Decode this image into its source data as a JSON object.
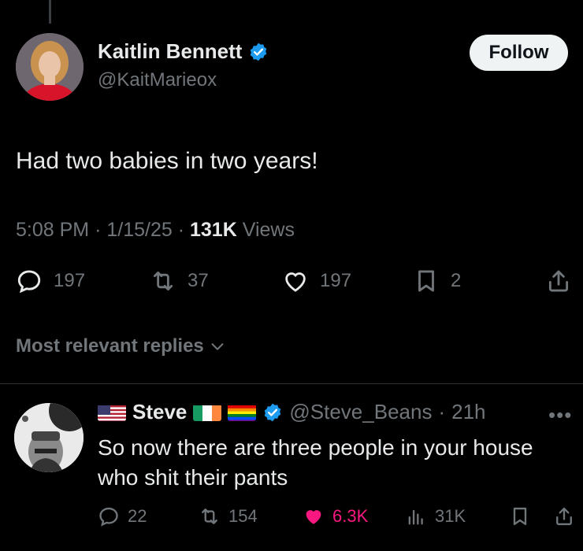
{
  "tweet": {
    "author_name": "Kaitlin Bennett",
    "author_handle": "@KaitMarieox",
    "follow_label": "Follow",
    "text": "Had two babies in two years!",
    "time": "5:08 PM",
    "date": "1/15/25",
    "views_count": "131K",
    "views_label": "Views",
    "separator": "·",
    "replies": "197",
    "reposts": "37",
    "likes": "197",
    "bookmarks": "2"
  },
  "replies_filter": {
    "label": "Most relevant replies"
  },
  "reply": {
    "author_name": "Steve",
    "author_handle": "@Steve_Beans",
    "time_ago": "21h",
    "separator": "·",
    "text": "So now there are three people in your house who shit their pants",
    "replies": "22",
    "reposts": "154",
    "likes": "6.3K",
    "views": "31K",
    "liked": true
  },
  "colors": {
    "background": "#000000",
    "text_primary": "#e7e9ea",
    "text_secondary": "#71767b",
    "verified_blue": "#1d9bf0",
    "like_pink": "#f91880",
    "follow_bg": "#eff3f4"
  },
  "icons": {
    "reply": "speech-bubble-icon",
    "repost": "repost-arrows-icon",
    "like": "heart-icon",
    "bookmark": "bookmark-icon",
    "share": "share-upload-icon",
    "views": "bar-chart-icon",
    "more": "more-dots-icon",
    "verified": "verified-badge-icon"
  }
}
